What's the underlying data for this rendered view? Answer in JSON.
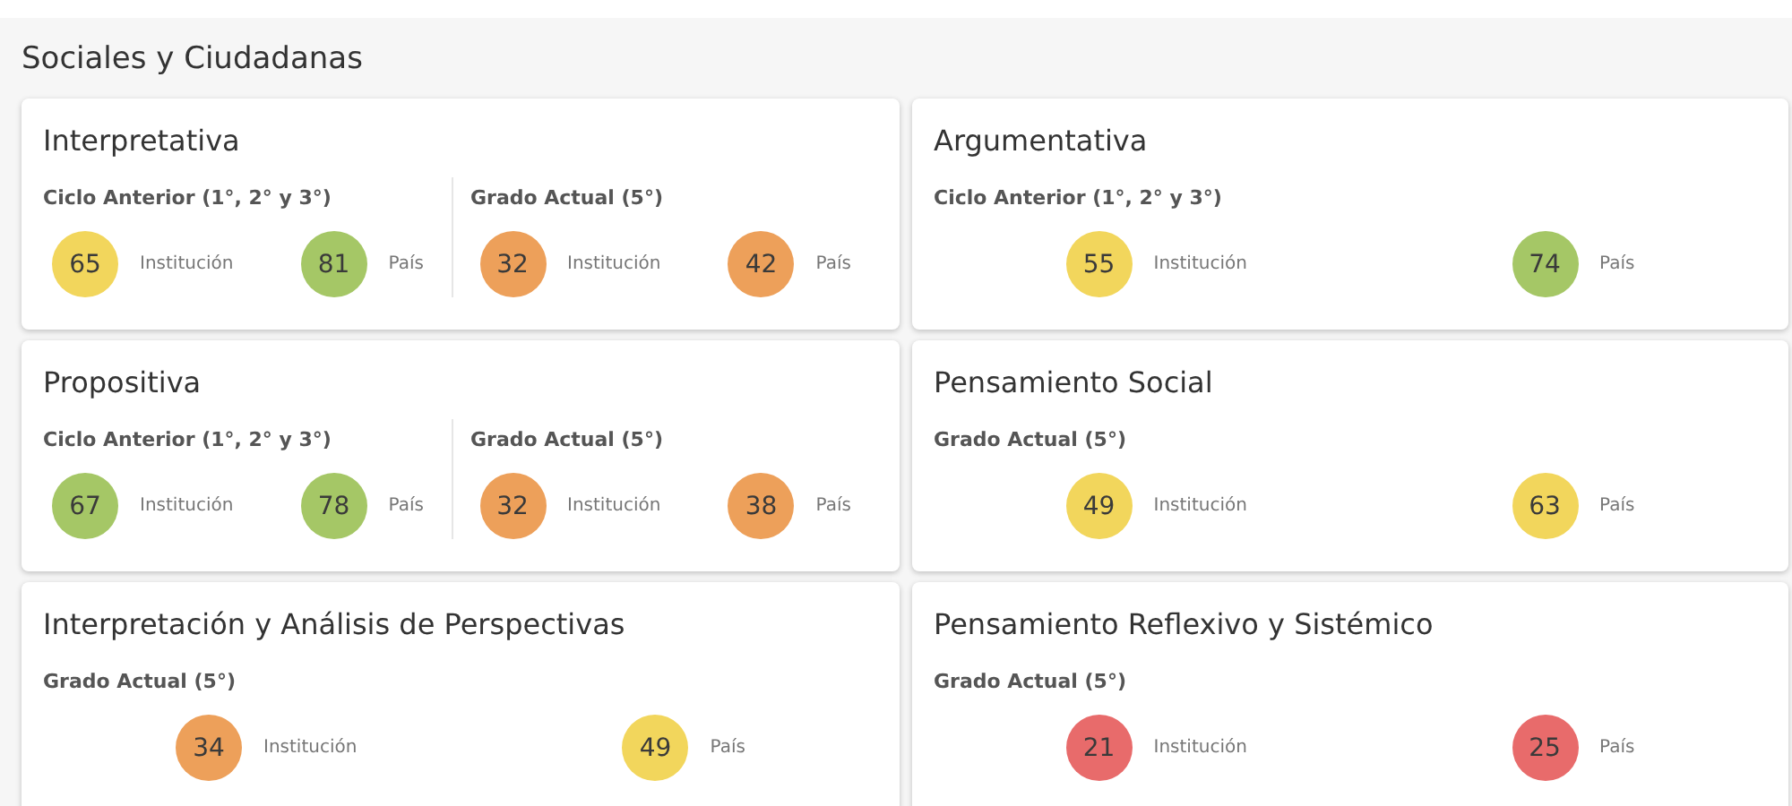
{
  "section": {
    "title": "Sociales y Ciudadanas"
  },
  "cards": [
    {
      "title": "Interpretativa",
      "groups": [
        {
          "label": "Ciclo Anterior (1°, 2° y 3°)",
          "scores": [
            {
              "value": "65",
              "label": "Institución",
              "color": "#f2d65c"
            },
            {
              "value": "81",
              "label": "País",
              "color": "#a5c766"
            }
          ]
        },
        {
          "label": "Grado Actual (5°)",
          "scores": [
            {
              "value": "32",
              "label": "Institución",
              "color": "#eda05a"
            },
            {
              "value": "42",
              "label": "País",
              "color": "#eda05a"
            }
          ]
        }
      ]
    },
    {
      "title": "Argumentativa",
      "groups": [
        {
          "label": "Ciclo Anterior (1°, 2° y 3°)",
          "scores": [
            {
              "value": "55",
              "label": "Institución",
              "color": "#f2d65c"
            },
            {
              "value": "74",
              "label": "País",
              "color": "#a5c766"
            }
          ]
        }
      ]
    },
    {
      "title": "Propositiva",
      "groups": [
        {
          "label": "Ciclo Anterior (1°, 2° y 3°)",
          "scores": [
            {
              "value": "67",
              "label": "Institución",
              "color": "#a5c766"
            },
            {
              "value": "78",
              "label": "País",
              "color": "#a5c766"
            }
          ]
        },
        {
          "label": "Grado Actual (5°)",
          "scores": [
            {
              "value": "32",
              "label": "Institución",
              "color": "#eda05a"
            },
            {
              "value": "38",
              "label": "País",
              "color": "#eda05a"
            }
          ]
        }
      ]
    },
    {
      "title": "Pensamiento Social",
      "groups": [
        {
          "label": "Grado Actual (5°)",
          "scores": [
            {
              "value": "49",
              "label": "Institución",
              "color": "#f2d65c"
            },
            {
              "value": "63",
              "label": "País",
              "color": "#f2d65c"
            }
          ]
        }
      ]
    },
    {
      "title": "Interpretación y Análisis de Perspectivas",
      "groups": [
        {
          "label": "Grado Actual (5°)",
          "scores": [
            {
              "value": "34",
              "label": "Institución",
              "color": "#eda05a"
            },
            {
              "value": "49",
              "label": "País",
              "color": "#f2d65c"
            }
          ]
        }
      ]
    },
    {
      "title": "Pensamiento Reflexivo y Sistémico",
      "groups": [
        {
          "label": "Grado Actual (5°)",
          "scores": [
            {
              "value": "21",
              "label": "Institución",
              "color": "#e86b6b"
            },
            {
              "value": "25",
              "label": "País",
              "color": "#e86b6b"
            }
          ]
        }
      ]
    }
  ]
}
